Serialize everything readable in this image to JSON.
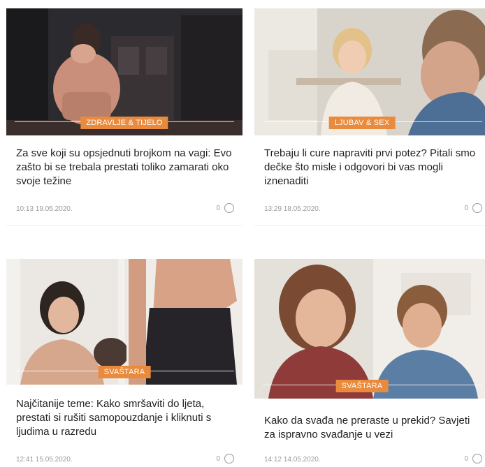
{
  "articles": [
    {
      "category": "ZDRAVLJE & TIJELO",
      "title": "Za sve koji su opsjednuti brojkom na vagi: Evo zašto bi se trebala prestati toliko zamarati oko svoje težine",
      "date": "10:13 19.05.2020.",
      "comments": "0"
    },
    {
      "category": "LJUBAV & SEX",
      "title": "Trebaju li cure napraviti prvi potez? Pitali smo dečke što misle i odgovori bi vas mogli iznenaditi",
      "date": "13:29 18.05.2020.",
      "comments": "0"
    },
    {
      "category": "SVAŠTARA",
      "title": "Najčitanije teme: Kako smršaviti do ljeta, prestati si rušiti samopouzdanje i kliknuti s ljudima u razredu",
      "date": "12:41 15.05.2020.",
      "comments": "0"
    },
    {
      "category": "SVAŠTARA",
      "title": "Kako da svađa ne preraste u prekid? Savjeti za ispravno svađanje u vezi",
      "date": "14:12 14.05.2020.",
      "comments": "0"
    }
  ],
  "colors": {
    "accent": "#e98a3c",
    "text": "#222222",
    "meta": "#9a9a9a"
  },
  "icons": {
    "comments": "comment-bubble-icon"
  }
}
